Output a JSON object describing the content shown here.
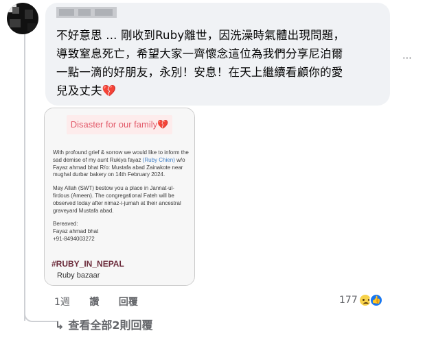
{
  "comment": {
    "text": "不好意思 ... 剛收到Ruby離世，因洗澡時氣體出現問題，\n導致窒息死亡，希望大家一齊懷念這位為我們分享尼泊爾\n一點一滴的好朋友，永別！安息！在天上繼續看顧你的愛\n兒及丈夫💔",
    "more_icon": "⋯"
  },
  "card": {
    "banner": "Disaster for our family💔",
    "p1_before": "With profound grief & sorrow we would like to inform the sad demise of my aunt Rukiya fayaz ",
    "p1_highlight": "(Ruby Chien)",
    "p1_after": " w/o Fayaz ahmad bhat R/o: Mustafa abad Zainakote near mughal durbar bakery on 14th February 2024.",
    "p2": "May Allah (SWT) bestow you a place in Jannat-ul-firdous (Ameen). The congregational Fateh will be observed today after nimaz-i-jumah at their ancestral graveyard Mustafa abad.",
    "p3_label": "Bereaved:",
    "p3_name": "Fayaz ahmad bhat",
    "p3_phone": "+91-8494003272",
    "hashtag": "#RUBY_IN_NEPAL",
    "subtitle": "Ruby bazaar"
  },
  "actions": {
    "time": "1週",
    "like": "讚",
    "reply": "回覆"
  },
  "reactions": {
    "count": "177",
    "like_icon": "👍"
  },
  "replies": {
    "arrow": "↳",
    "label": "查看全部2則回覆"
  }
}
